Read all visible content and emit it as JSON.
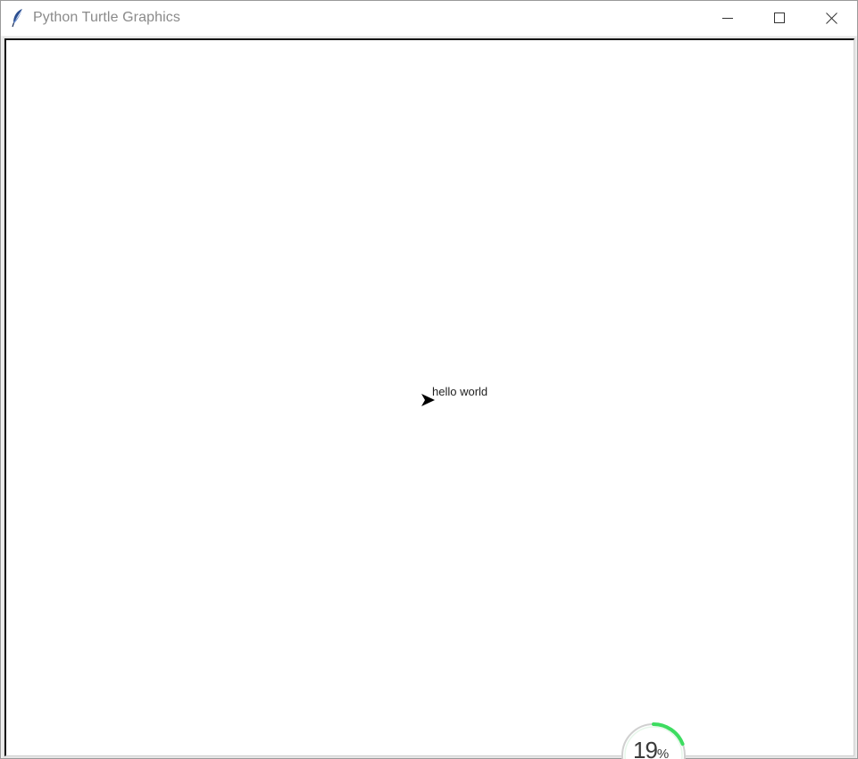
{
  "window": {
    "title": "Python Turtle Graphics",
    "icon": "feather-icon",
    "controls": [
      "minimize-icon",
      "maximize-icon",
      "close-icon"
    ]
  },
  "canvas": {
    "text": "hello world",
    "turtle_icon": "arrow-turtle-icon"
  },
  "overlay": {
    "progress_value": "19",
    "progress_unit": "%",
    "progress_fraction": 0.19,
    "ring_color": "#3ddc60"
  }
}
